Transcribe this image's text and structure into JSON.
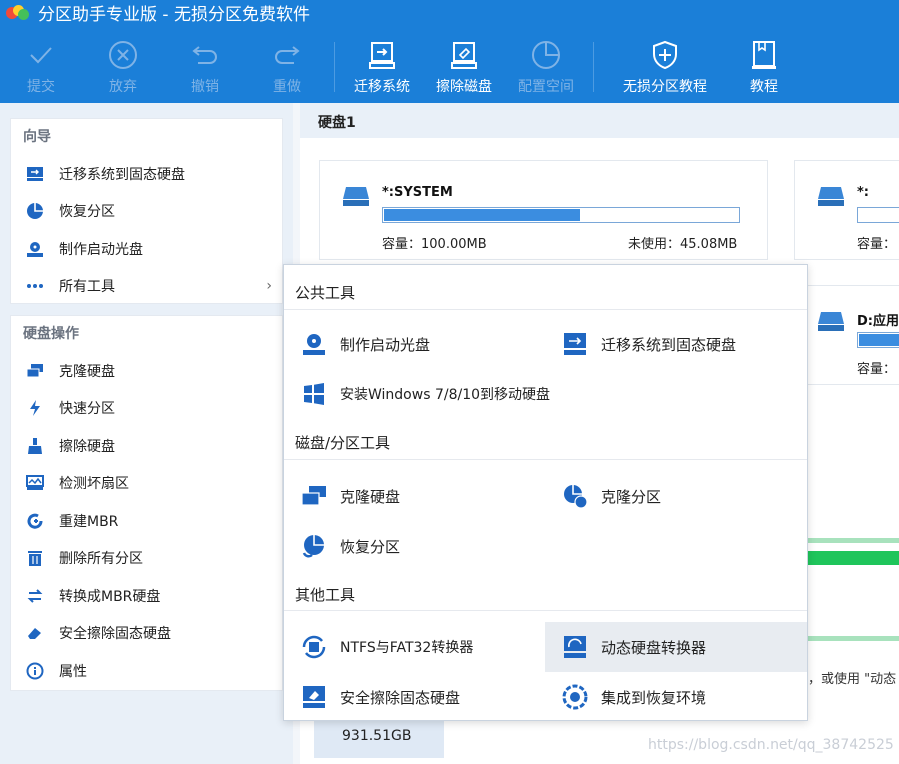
{
  "app": {
    "title": "分区助手专业版 - 无损分区免费软件"
  },
  "toolbar": {
    "items": [
      {
        "label": "提交",
        "icon": "check-icon",
        "enabled": false
      },
      {
        "label": "放弃",
        "icon": "cancel-circle-icon",
        "enabled": false
      },
      {
        "label": "撤销",
        "icon": "undo-icon",
        "enabled": false
      },
      {
        "label": "重做",
        "icon": "redo-icon",
        "enabled": false
      },
      {
        "label": "迁移系统",
        "icon": "migrate-os-icon",
        "enabled": true
      },
      {
        "label": "擦除磁盘",
        "icon": "wipe-disk-icon",
        "enabled": true
      },
      {
        "label": "配置空间",
        "icon": "pie-chart-icon",
        "enabled": false
      },
      {
        "label": "无损分区教程",
        "icon": "shield-icon",
        "enabled": true
      },
      {
        "label": "教程",
        "icon": "tutorial-icon",
        "enabled": true
      }
    ]
  },
  "sidebar": {
    "guide": {
      "title": "向导",
      "items": [
        {
          "label": "迁移系统到固态硬盘",
          "icon": "migrate-ssd-icon"
        },
        {
          "label": "恢复分区",
          "icon": "recover-partition-icon"
        },
        {
          "label": "制作启动光盘",
          "icon": "boot-disc-icon"
        },
        {
          "label": "所有工具",
          "icon": "more-dots-icon",
          "chevron": "›"
        }
      ]
    },
    "disk_ops": {
      "title": "硬盘操作",
      "items": [
        {
          "label": "克隆硬盘",
          "icon": "clone-disk-icon"
        },
        {
          "label": "快速分区",
          "icon": "quick-partition-icon"
        },
        {
          "label": "擦除硬盘",
          "icon": "wipe-icon"
        },
        {
          "label": "检测坏扇区",
          "icon": "bad-sector-icon"
        },
        {
          "label": "重建MBR",
          "icon": "rebuild-mbr-icon"
        },
        {
          "label": "删除所有分区",
          "icon": "delete-icon"
        },
        {
          "label": "转换成MBR硬盘",
          "icon": "convert-icon"
        },
        {
          "label": "安全擦除固态硬盘",
          "icon": "secure-erase-icon"
        },
        {
          "label": "属性",
          "icon": "info-icon"
        }
      ]
    }
  },
  "main": {
    "disk_label": "硬盘1",
    "partitions": [
      {
        "name": "*:SYSTEM",
        "capacity": "容量：100.00MB",
        "unused": "未使用：45.08MB",
        "used_fraction": 0.55
      },
      {
        "name": "*:",
        "capacity": "容量："
      },
      {
        "name": "D:应用",
        "capacity": "容量："
      }
    ],
    "hint_text": "，或使用 \"动态",
    "disk_size": "931.51GB",
    "watermark": "https://blog.csdn.net/qq_38742525"
  },
  "popup": {
    "sections": [
      {
        "title": "公共工具",
        "items": [
          {
            "label": "制作启动光盘",
            "icon": "boot-disc-icon"
          },
          {
            "label": "迁移系统到固态硬盘",
            "icon": "migrate-ssd-icon"
          },
          {
            "label": "安装Windows 7/8/10到移动硬盘",
            "icon": "windows-icon"
          }
        ]
      },
      {
        "title": "磁盘/分区工具",
        "items": [
          {
            "label": "克隆硬盘",
            "icon": "clone-disk-icon"
          },
          {
            "label": "克隆分区",
            "icon": "clone-partition-icon"
          },
          {
            "label": "恢复分区",
            "icon": "recover-partition-icon"
          }
        ]
      },
      {
        "title": "其他工具",
        "items": [
          {
            "label": "NTFS与FAT32转换器",
            "icon": "ntfs-fat32-icon"
          },
          {
            "label": "动态硬盘转换器",
            "icon": "dynamic-disk-icon"
          },
          {
            "label": "安全擦除固态硬盘",
            "icon": "secure-erase-icon"
          },
          {
            "label": "集成到恢复环境",
            "icon": "recovery-env-icon"
          }
        ]
      }
    ]
  },
  "colors": {
    "title_bar": "#1b7fd8",
    "accent": "#3b8de0",
    "green": "#1fc55b"
  }
}
